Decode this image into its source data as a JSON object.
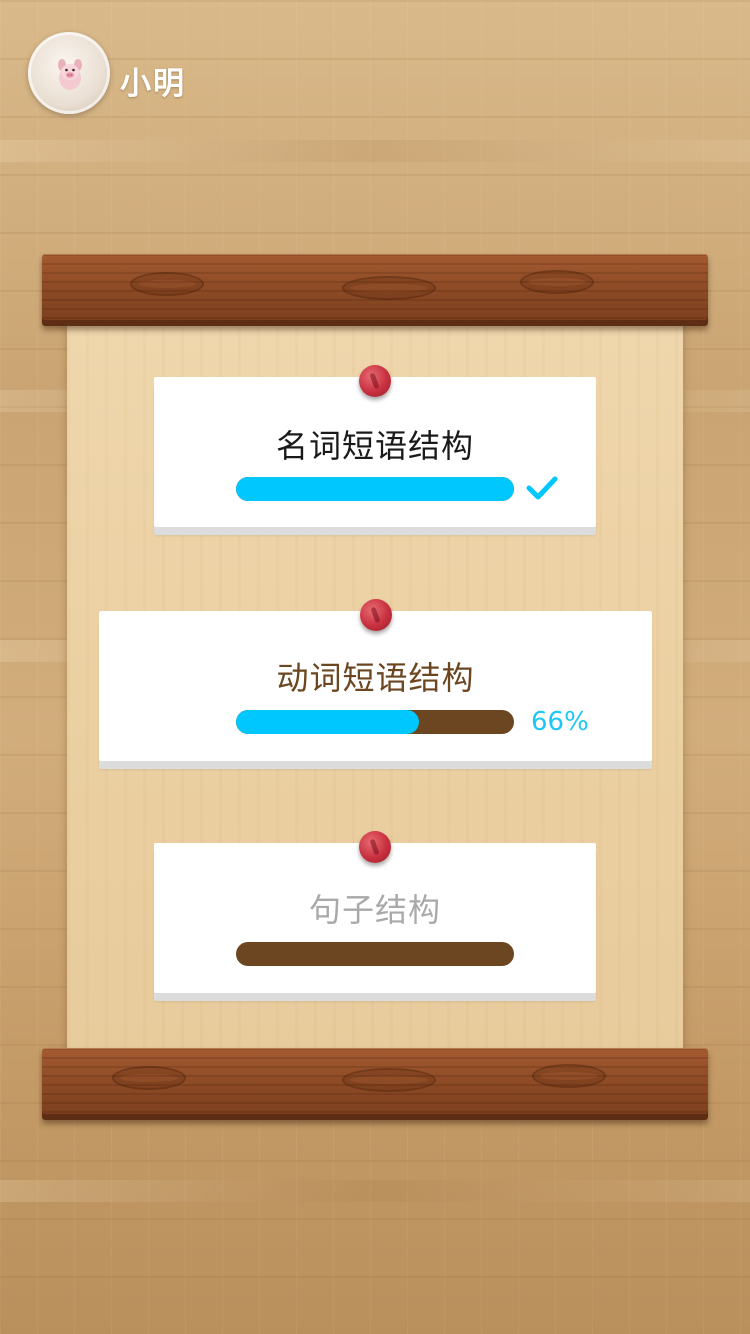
{
  "user": {
    "name": "小明",
    "avatar_icon": "pig-avatar-icon"
  },
  "units": [
    {
      "title": "名词短语结构",
      "progress": 1.0,
      "status": "completed",
      "status_icon": "check-icon",
      "title_color": "#1a1a1a"
    },
    {
      "title": "动词短语结构",
      "progress": 0.66,
      "status": "in-progress",
      "percent_label": "66%",
      "title_color": "#6b4620"
    },
    {
      "title": "句子结构",
      "progress": 0.0,
      "status": "locked",
      "title_color": "#a9a9a9"
    }
  ],
  "colors": {
    "progress_fill": "#00c8ff",
    "progress_track": "#6b4620",
    "pin": "#c8303f",
    "rod": "#8c4a25",
    "paper": "#ebd0a2"
  }
}
